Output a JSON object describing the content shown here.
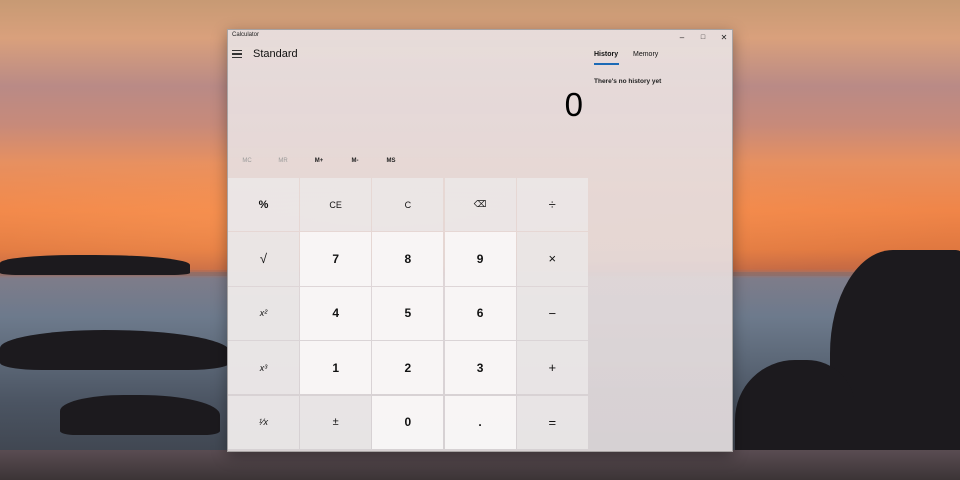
{
  "window": {
    "app_title": "Calculator",
    "controls": {
      "minimize": "–",
      "maximize": "□",
      "close": "✕"
    }
  },
  "header": {
    "mode": "Standard",
    "menu_icon": "hamburger-icon"
  },
  "display": {
    "value": "0"
  },
  "memory_buttons": [
    {
      "label": "MC",
      "enabled": false
    },
    {
      "label": "MR",
      "enabled": false
    },
    {
      "label": "M+",
      "enabled": true
    },
    {
      "label": "M-",
      "enabled": true
    },
    {
      "label": "MS",
      "enabled": true
    }
  ],
  "keys": {
    "percent": "%",
    "clear_entry": "CE",
    "clear": "C",
    "backspace": "⌫",
    "divide": "÷",
    "sqrt": "√",
    "seven": "7",
    "eight": "8",
    "nine": "9",
    "multiply": "×",
    "square": "x²",
    "four": "4",
    "five": "5",
    "six": "6",
    "subtract": "−",
    "cube": "x³",
    "one": "1",
    "two": "2",
    "three": "3",
    "add": "+",
    "reciprocal": "¹⁄x",
    "negate": "±",
    "zero": "0",
    "decimal": ".",
    "equals": "="
  },
  "panel": {
    "tabs": [
      "History",
      "Memory"
    ],
    "active_tab": "History",
    "accent_color": "#1c6ab6",
    "empty_message": "There's no history yet"
  }
}
